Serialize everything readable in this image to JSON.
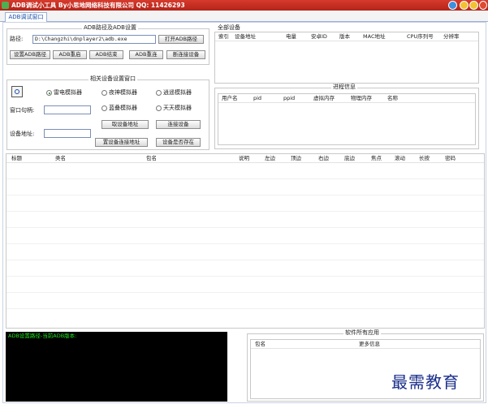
{
  "window": {
    "title": "ADB调试小工具 By小思地网络科技有限公司 QQ: 11426293",
    "colors": {
      "titlebar": "#c42e22",
      "accent": "#1a4fa8",
      "log_text": "#22e022"
    }
  },
  "tabs": [
    {
      "label": "ADB调试窗口"
    }
  ],
  "adb_settings": {
    "title": "ADB路径及ADB设置",
    "path_label": "路径:",
    "path_value": "D:\\Changzhi\\dnplayer2\\adb.exe",
    "open_button": "打开ADB路径",
    "buttons": [
      "设置ADB路径",
      "ADB重启",
      "ADB结束",
      "ADB重连",
      "断连接设备"
    ]
  },
  "emulator_settings": {
    "title": "相关设备设置窗口",
    "radios": [
      {
        "label": "雷电模拟器",
        "checked": true
      },
      {
        "label": "夜神模拟器",
        "checked": false
      },
      {
        "label": "逍遥模拟器",
        "checked": false
      },
      {
        "label": "蓝叠模拟器",
        "checked": false
      },
      {
        "label": "天天模拟器",
        "checked": false
      }
    ],
    "port_label": "窗口句柄:",
    "port_value": "",
    "address_label": "设备地址:",
    "address_value": "",
    "buttons": [
      "取设备地址",
      "连接设备",
      "置设备连接地址",
      "设备是否存在"
    ]
  },
  "all_devices": {
    "title": "全部设备",
    "columns": [
      "索引",
      "设备地址",
      "电量",
      "安卓ID",
      "版本",
      "MAC地址",
      "CPU序列号",
      "分辨率"
    ]
  },
  "process_info": {
    "title": "进程信息",
    "columns": [
      "用户名",
      "pid",
      "ppid",
      "虚拟内存",
      "物理内存",
      "名称"
    ]
  },
  "ui_table": {
    "columns": [
      "标题",
      "类名",
      "包名",
      "说明",
      "左边",
      "顶边",
      "右边",
      "底边",
      "焦点",
      "滚动",
      "长按",
      "密码"
    ]
  },
  "log": {
    "text": "ADB设置路径-当前ADB版本:"
  },
  "installed_apps": {
    "title": "软件所有应用",
    "columns": [
      "包名",
      "更多信息"
    ]
  },
  "watermark": {
    "text": "最需教育"
  }
}
